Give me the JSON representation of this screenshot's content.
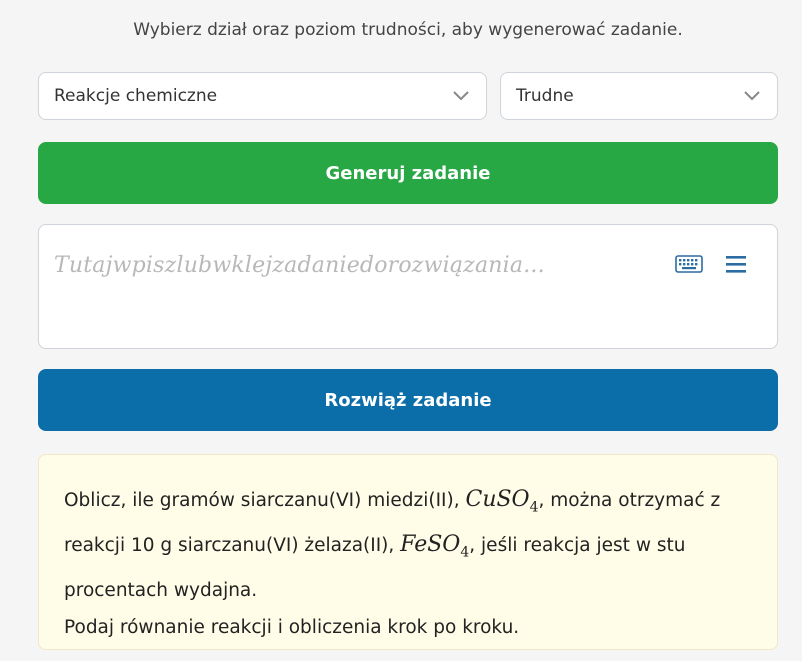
{
  "header": {
    "subtitle": "Wybierz dział oraz poziom trudności, aby wygenerować zadanie."
  },
  "controls": {
    "topic_select": {
      "value": "Reakcje chemiczne"
    },
    "level_select": {
      "value": "Trudne"
    },
    "generate_label": "Generuj zadanie"
  },
  "task_input": {
    "placeholder": "Tutajwpiszlubwklejzadaniedorozwiązania..."
  },
  "solve_label": "Rozwiąż zadanie",
  "task": {
    "p1_a": "Oblicz, ile gramów siarczanu(VI) miedzi(II),",
    "formula1": "CuSO",
    "formula1_sub": "4",
    "p1_b": ", można otrzymać z reakcji 10 g siarczanu(VI) żelaza(II),",
    "formula2": "FeSO",
    "formula2_sub": "4",
    "p1_c": ", jeśli reakcja jest w stu procentach wydajna.",
    "p2": "Podaj równanie reakcji i obliczenia krok po kroku."
  },
  "colors": {
    "generate_button": "#28a745",
    "solve_button": "#0b6ea8",
    "task_background": "#fffde8",
    "icon_blue": "#2b6ca3"
  },
  "icons": [
    "chevron-down-icon",
    "keyboard-icon",
    "menu-icon"
  ]
}
